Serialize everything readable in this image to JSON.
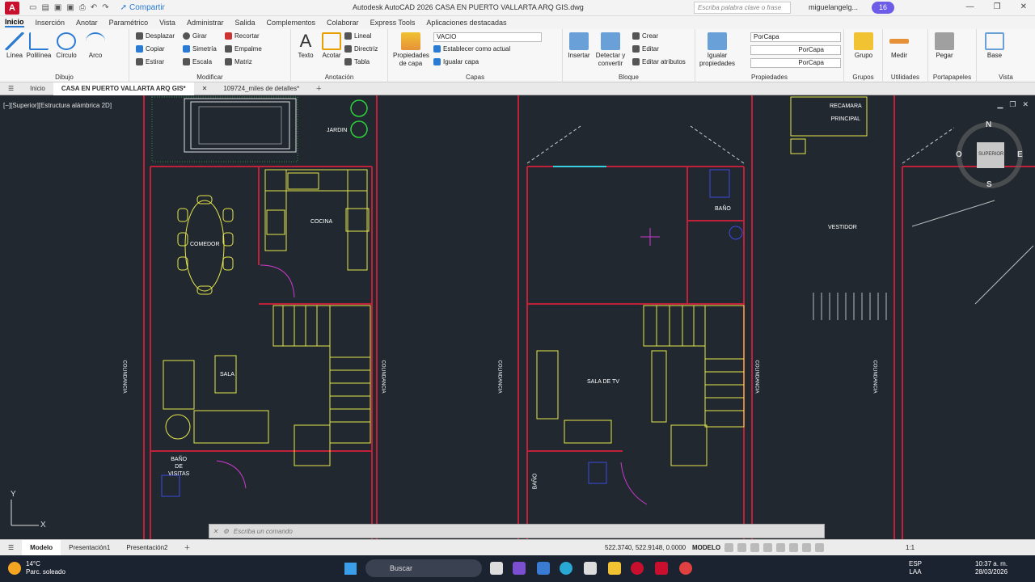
{
  "app": {
    "logo_letter": "A",
    "share_label": "Compartir",
    "window_title": "Autodesk AutoCAD 2026    CASA EN PUERTO VALLARTA ARQ GIS.dwg",
    "search_placeholder": "Escriba palabra clave o frase",
    "user_name": "miguelangelg...",
    "badge_count": "16"
  },
  "ribbon_tabs": [
    "Inicio",
    "Inserción",
    "Anotar",
    "Paramétrico",
    "Vista",
    "Administrar",
    "Salida",
    "Complementos",
    "Colaborar",
    "Express Tools",
    "Aplicaciones destacadas"
  ],
  "ribbon": {
    "dibujo": {
      "name": "Dibujo",
      "linea": "Línea",
      "polilinea": "Polilínea",
      "circulo": "Círculo",
      "arco": "Arco"
    },
    "modificar": {
      "name": "Modificar",
      "desplazar": "Desplazar",
      "girar": "Girar",
      "recortar": "Recortar",
      "copiar": "Copiar",
      "simetria": "Simetría",
      "empalme": "Empalme",
      "estirar": "Estirar",
      "escala": "Escala",
      "matriz": "Matriz"
    },
    "anotacion": {
      "name": "Anotación",
      "texto": "Texto",
      "acotar": "Acotar",
      "lineal": "Lineal",
      "directriz": "Directriz",
      "tabla": "Tabla"
    },
    "capas": {
      "name": "Capas",
      "propiedades": "Propiedades de capa",
      "layer_value": "VACIO",
      "establecer": "Establecer como actual",
      "igualar": "Igualar capa"
    },
    "bloque": {
      "name": "Bloque",
      "insertar": "Insertar",
      "detectar": "Detectar y convertir",
      "crear": "Crear",
      "editar": "Editar",
      "editar_atributos": "Editar atributos"
    },
    "propiedades": {
      "name": "Propiedades",
      "igualar": "Igualar propiedades",
      "color": "PorCapa",
      "linetype": "PorCapa",
      "lineweight": "PorCapa"
    },
    "grupos": {
      "name": "Grupos",
      "grupo": "Grupo"
    },
    "utilidades": {
      "name": "Utilidades",
      "medir": "Medir"
    },
    "portapapeles": {
      "name": "Portapapeles",
      "pegar": "Pegar"
    },
    "vista": {
      "name": "Vista",
      "base": "Base"
    }
  },
  "file_tabs": [
    "Inicio",
    "CASA EN PUERTO VALLARTA ARQ GIS*",
    "109724_miles de detalles*"
  ],
  "viewport_label": "[−][Superior][Estructura alámbrica 2D]",
  "viewcube": {
    "top": "SUPERIOR",
    "n": "N",
    "s": "S",
    "e": "E",
    "w": "O"
  },
  "rooms": {
    "jardin": "JARDIN",
    "comedor": "COMEDOR",
    "cocina": "COCINA",
    "sala": "SALA",
    "bano_visitas_1": "BAÑO",
    "bano_visitas_2": "DE",
    "bano_visitas_3": "VISITAS",
    "bano": "BAÑO",
    "sala_tv": "SALA DE TV",
    "bano2": "BAÑO",
    "recamara_1": "RECAMARA",
    "recamara_2": "PRINCIPAL",
    "vestidor": "VESTIDOR",
    "colindancia": "COLINDANCIA"
  },
  "command_placeholder": "Escriba un comando",
  "layout_tabs": [
    "Modelo",
    "Presentación1",
    "Presentación2"
  ],
  "status": {
    "coords": "522.3740, 522.9148, 0.0000",
    "model": "MODELO",
    "scale": "1:1"
  },
  "taskbar": {
    "temp": "14°C",
    "weather": "Parc. soleado",
    "search": "Buscar",
    "lang_1": "ESP",
    "lang_2": "LAA",
    "time": "10:37 a. m.",
    "date": "28/03/2026"
  },
  "colors": {
    "canvas": "#212830",
    "walls": "#c0203a",
    "furniture": "#e8e84a",
    "accent": "#2a7bd4"
  }
}
